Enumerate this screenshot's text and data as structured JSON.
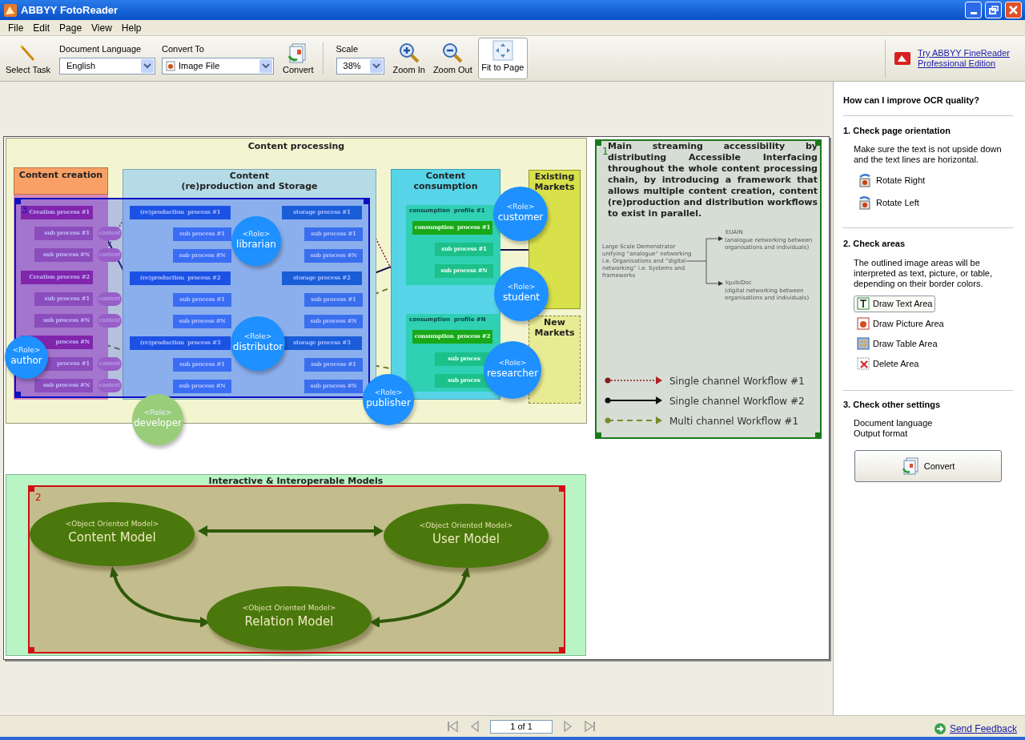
{
  "window": {
    "title": "ABBYY FotoReader"
  },
  "menu": [
    {
      "label": "File"
    },
    {
      "label": "Edit"
    },
    {
      "label": "Page"
    },
    {
      "label": "View"
    },
    {
      "label": "Help"
    }
  ],
  "toolbar": {
    "select_task": "Select Task",
    "document_language": {
      "label": "Document Language",
      "value": "English"
    },
    "convert_to": {
      "label": "Convert To",
      "value": "Image File"
    },
    "convert": "Convert",
    "scale": {
      "label": "Scale",
      "value": "38%"
    },
    "zoom_in": "Zoom In",
    "zoom_out": "Zoom Out",
    "fit_to_page": {
      "label": "Fit to Page",
      "selected": true
    }
  },
  "promo": "Try ABBYY FineReader Professional Edition",
  "document": {
    "content_processing": {
      "title": "Content processing",
      "columns": [
        {
          "title": "Content creation",
          "kind": "creation"
        },
        {
          "title": "Content\n(re)production and Storage",
          "kind": "production"
        },
        {
          "title": "Content consumption",
          "kind": "consumption"
        },
        {
          "title": "Existing Markets",
          "kind": "existing_market"
        },
        {
          "title": "New Markets",
          "kind": "new_market"
        }
      ],
      "processes": [
        {
          "text": "Creation process #1",
          "kind": "creation"
        },
        {
          "text": "sub process #1",
          "kind": "sub_creation"
        },
        {
          "text": "sub process #N",
          "kind": "sub_creation"
        },
        {
          "text": "Creation process #2",
          "kind": "creation"
        },
        {
          "text": "sub process #1",
          "kind": "sub_creation"
        },
        {
          "text": "sub process #N",
          "kind": "sub_creation"
        },
        {
          "text": "process #N",
          "kind": "creation"
        },
        {
          "text": "process #1",
          "kind": "sub_creation"
        },
        {
          "text": "sub process #N",
          "kind": "sub_creation"
        },
        {
          "text": "(re)production  process #1",
          "kind": "production"
        },
        {
          "text": "sub process #1",
          "kind": "sub_production"
        },
        {
          "text": "sub process #N",
          "kind": "sub_production"
        },
        {
          "text": "(re)production  process #2",
          "kind": "production"
        },
        {
          "text": "sub process #1",
          "kind": "sub_production"
        },
        {
          "text": "sub process #N",
          "kind": "sub_production"
        },
        {
          "text": "(re)production  process #3",
          "kind": "production"
        },
        {
          "text": "sub process #1",
          "kind": "sub_production"
        },
        {
          "text": "sub process #N",
          "kind": "sub_production"
        },
        {
          "text": "storage process #1",
          "kind": "storage"
        },
        {
          "text": "sub process #1",
          "kind": "sub_storage"
        },
        {
          "text": "sub process #N",
          "kind": "sub_storage"
        },
        {
          "text": "storage process #2",
          "kind": "storage"
        },
        {
          "text": "sub process #1",
          "kind": "sub_storage"
        },
        {
          "text": "sub process #N",
          "kind": "sub_storage"
        },
        {
          "text": "storage process #3",
          "kind": "storage"
        },
        {
          "text": "sub process #1",
          "kind": "sub_storage"
        },
        {
          "text": "sub process #N",
          "kind": "sub_storage"
        },
        {
          "text": "consumption  process #1",
          "kind": "consumption"
        },
        {
          "text": "sub process #1",
          "kind": "sub_consumption"
        },
        {
          "text": "sub process #N",
          "kind": "sub_consumption"
        },
        {
          "text": "consumption  process #2",
          "kind": "consumption"
        },
        {
          "text": "sub proces",
          "kind": "sub_consumption"
        },
        {
          "text": "sub proces",
          "kind": "sub_consumption"
        }
      ],
      "profiles": [
        {
          "title": "consumption  profile #1"
        },
        {
          "title": "consumption  profile #N"
        }
      ],
      "content_tags": [
        "content",
        "content",
        "content",
        "content",
        "content",
        "content"
      ],
      "roles": [
        {
          "tag": "<Role>",
          "name": "librarian",
          "color": "#1e90ff"
        },
        {
          "tag": "<Role>",
          "name": "distributor",
          "color": "#1e90ff"
        },
        {
          "tag": "<Role>",
          "name": "author",
          "color": "#1e90ff"
        },
        {
          "tag": "<Role>",
          "name": "customer",
          "color": "#1e90ff"
        },
        {
          "tag": "<Role>",
          "name": "student",
          "color": "#1e90ff"
        },
        {
          "tag": "<Role>",
          "name": "researcher",
          "color": "#1e90ff"
        },
        {
          "tag": "<Role>",
          "name": "publisher",
          "color": "#1e90ff"
        },
        {
          "tag": "<Role>",
          "name": "developer",
          "color": "#9acd7a"
        }
      ]
    },
    "summary": {
      "paragraph": "Main streaming accessibility by distributing Accessible Interfacing throughout the whole content processing chain, by introducing a framework that allows multiple content creation, content (re)production and distribution workflows to exist in parallel.",
      "demonstrator": "Large Scale Demonstrator\nunifying “analogue” networking\ni.e. Organisations and “digital\nnetworking” i.e. Systems and\nframeworks",
      "branches": [
        {
          "name": "EUAIN",
          "detail": "(analogue networking between\norganisations and individuals)"
        },
        {
          "name": "IquibiDoc",
          "detail": "(digital networking between\norganisations and individuals)"
        }
      ]
    },
    "legend": [
      {
        "label": "Single channel Workflow #1",
        "kind": "dotted"
      },
      {
        "label": "Single channel Workflow #2",
        "kind": "solid"
      },
      {
        "label": "Multi channel Workflow #1",
        "kind": "dashed"
      }
    ],
    "models": {
      "title": "Interactive & Interoperable Models",
      "items": [
        {
          "tag": "<Object Oriented Model>",
          "name": "Content Model"
        },
        {
          "tag": "<Object Oriented Model>",
          "name": "User Model"
        },
        {
          "tag": "<Object Oriented Model>",
          "name": "Relation Model"
        }
      ]
    },
    "areas": [
      {
        "number": "3",
        "kind": "table"
      },
      {
        "number": "1",
        "kind": "text"
      },
      {
        "number": "2",
        "kind": "picture"
      }
    ]
  },
  "task_pane": {
    "title": "How can I improve OCR quality?",
    "orientation": {
      "heading": "1. Check page orientation",
      "text": "Make sure the text is not upside down and the text lines are horizontal.",
      "actions": [
        {
          "label": "Rotate Right",
          "kind": "rotate_right"
        },
        {
          "label": "Rotate Left",
          "kind": "rotate_left"
        }
      ]
    },
    "areas": {
      "heading": "2. Check areas",
      "text": "The outlined image areas will be interpreted as text, picture, or table, depending on their border colors.",
      "tools": [
        {
          "label": "Draw Text Area",
          "kind": "text",
          "selected": true
        },
        {
          "label": "Draw Picture Area",
          "kind": "picture",
          "selected": false
        },
        {
          "label": "Draw Table Area",
          "kind": "table",
          "selected": false
        },
        {
          "label": "Delete Area",
          "kind": "delete",
          "selected": false
        }
      ]
    },
    "settings": {
      "heading": "3. Check other settings",
      "lines": [
        "Document language",
        "Output format"
      ],
      "button": "Convert"
    }
  },
  "status_bar": {
    "page": "1 of 1",
    "feedback": "Send Feedback"
  }
}
